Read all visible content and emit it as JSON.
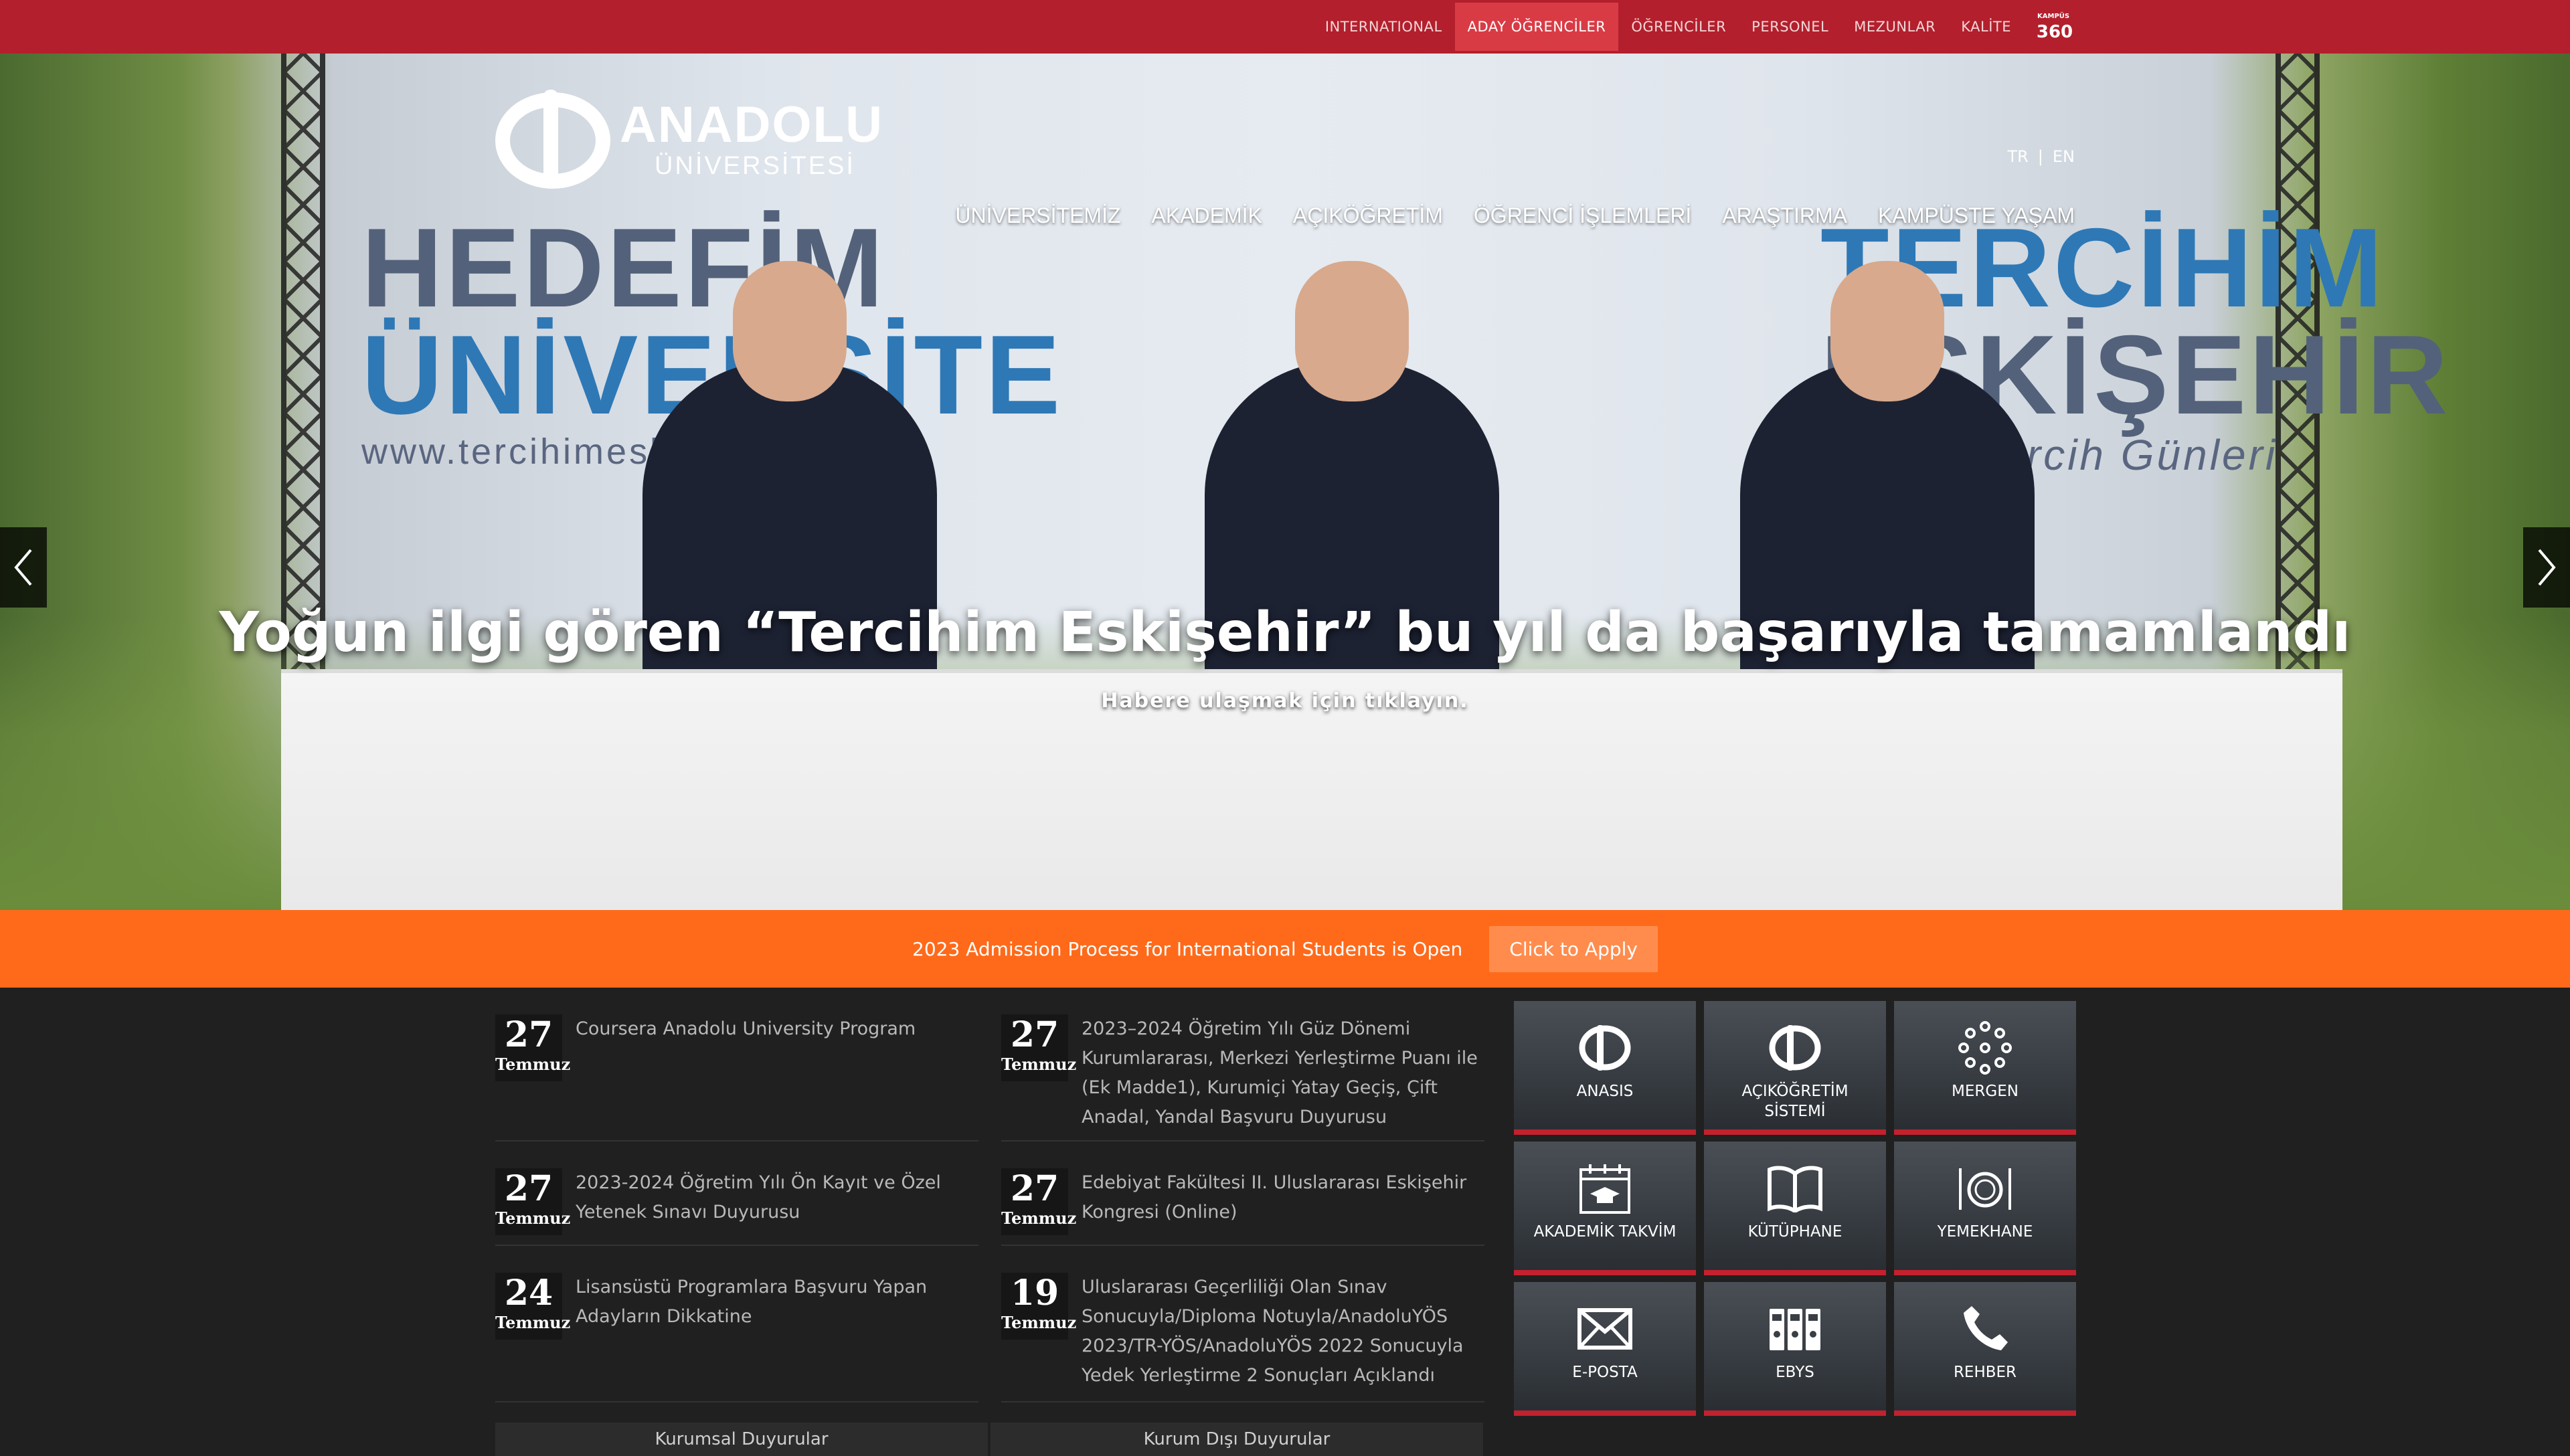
{
  "topnav": {
    "items": [
      "INTERNATIONAL",
      "ADAY ÖĞRENCİLER",
      "ÖĞRENCİLER",
      "PERSONEL",
      "MEZUNLAR",
      "KALİTE"
    ],
    "active_index": 1,
    "kampus360_small": "KAMPÜS",
    "kampus360_label": "360"
  },
  "header": {
    "logo_line1": "ANADOLU",
    "logo_line2": "ÜNİVERSİTESİ",
    "lang_tr": "TR",
    "lang_sep": "|",
    "lang_en": "EN",
    "nav": [
      "ÜNİVERSİTEMİZ",
      "AKADEMİK",
      "AÇIKÖĞRETİM",
      "ÖĞRENCİ İŞLEMLERİ",
      "ARAŞTIRMA",
      "KAMPÜSTE YAŞAM"
    ]
  },
  "hero": {
    "banner_left_1": "HEDEFİM",
    "banner_left_2": "ÜNİVERSİTE",
    "banner_left_url": "www.tercihimeskise",
    "banner_right_1": "TERCİHİM",
    "banner_right_2": "ESKİŞEHİR",
    "banner_right_sub": "vrimiçi Tercih Günleri",
    "headline": "Yoğun ilgi gören “Tercihim Eskişehir” bu yıl da başarıyla tamamlandı",
    "subline": "Habere ulaşmak için tıklayın.",
    "prev": "‹",
    "next": "›"
  },
  "promo": {
    "text": "2023 Admission Process for International Students is Open",
    "button": "Click to Apply"
  },
  "news": [
    {
      "day": "27",
      "month": "Temmuz",
      "title": "Coursera Anadolu University Program"
    },
    {
      "day": "27",
      "month": "Temmuz",
      "title": "2023–2024 Öğretim Yılı Güz Dönemi Kurumlararası, Merkezi Yerleştirme Puanı ile (Ek Madde1), Kurumiçi Yatay Geçiş, Çift Anadal, Yandal Başvuru Duyurusu"
    },
    {
      "day": "27",
      "month": "Temmuz",
      "title": "2023-2024 Öğretim Yılı Ön Kayıt ve Özel Yetenek Sınavı Duyurusu"
    },
    {
      "day": "27",
      "month": "Temmuz",
      "title": "Edebiyat Fakültesi II. Uluslararası Eskişehir Kongresi (Online)"
    },
    {
      "day": "24",
      "month": "Temmuz",
      "title": "Lisansüstü Programlara Başvuru Yapan Adayların Dikkatine"
    },
    {
      "day": "19",
      "month": "Temmuz",
      "title": "Uluslararası Geçerliliği Olan Sınav Sonucuyla/Diploma Notuyla/AnadoluYÖS 2023/TR-YÖS/AnadoluYÖS 2022 Sonucuyla Yedek Yerleştirme 2 Sonuçları Açıklandı"
    }
  ],
  "tabs": [
    "Kurumsal Duyurular",
    "Kurum Dışı Duyurular"
  ],
  "tiles": [
    {
      "label": "ANASIS",
      "icon": "anadolu-logo-icon"
    },
    {
      "label": "AÇIKÖĞRETİM SİSTEMİ",
      "icon": "anadolu-logo-icon"
    },
    {
      "label": "MERGEN",
      "icon": "network-icon"
    },
    {
      "label": "AKADEMİK TAKVİM",
      "icon": "calendar-icon"
    },
    {
      "label": "KÜTÜPHANE",
      "icon": "book-icon"
    },
    {
      "label": "YEMEKHANE",
      "icon": "dining-icon"
    },
    {
      "label": "E-POSTA",
      "icon": "mail-icon"
    },
    {
      "label": "EBYS",
      "icon": "binders-icon"
    },
    {
      "label": "REHBER",
      "icon": "phone-icon"
    }
  ],
  "colors": {
    "topbar": "#b31f2c",
    "active": "#d93b45",
    "promo": "#ff6a1a",
    "tile_accent": "#c3212e"
  }
}
